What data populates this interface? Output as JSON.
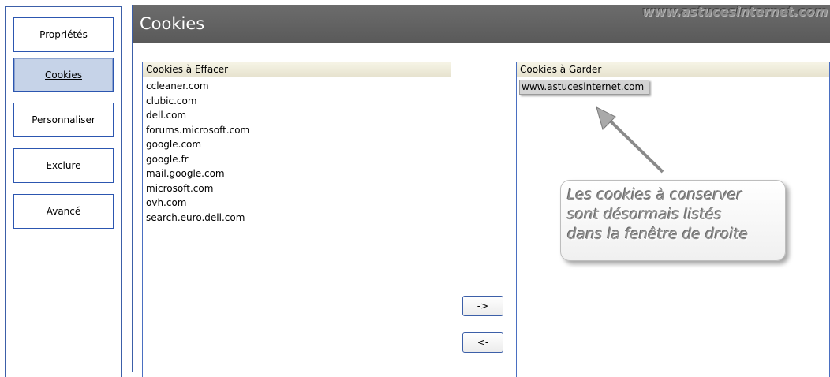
{
  "sidebar": {
    "items": [
      {
        "label": "Propriétés"
      },
      {
        "label": "Cookies"
      },
      {
        "label": "Personnaliser"
      },
      {
        "label": "Exclure"
      },
      {
        "label": "Avancé"
      }
    ],
    "active_index": 1
  },
  "header": {
    "title": "Cookies",
    "watermark": "www.astucesinternet.com"
  },
  "delete_panel": {
    "header": "Cookies à Effacer",
    "items": [
      "ccleaner.com",
      "clubic.com",
      "dell.com",
      "forums.microsoft.com",
      "google.com",
      "google.fr",
      "mail.google.com",
      "microsoft.com",
      "ovh.com",
      "search.euro.dell.com"
    ]
  },
  "keep_panel": {
    "header": "Cookies à Garder",
    "items": [
      "www.astucesinternet.com"
    ]
  },
  "buttons": {
    "move_right": "->",
    "move_left": "<-"
  },
  "annotation": {
    "lines": [
      "Les cookies à conserver",
      "sont désormais listés",
      "dans la fenêtre de droite"
    ]
  },
  "colors": {
    "border_blue": "#3c5fa8",
    "active_bg": "#c6d3e8",
    "header_gray": "#6c6c6c"
  }
}
